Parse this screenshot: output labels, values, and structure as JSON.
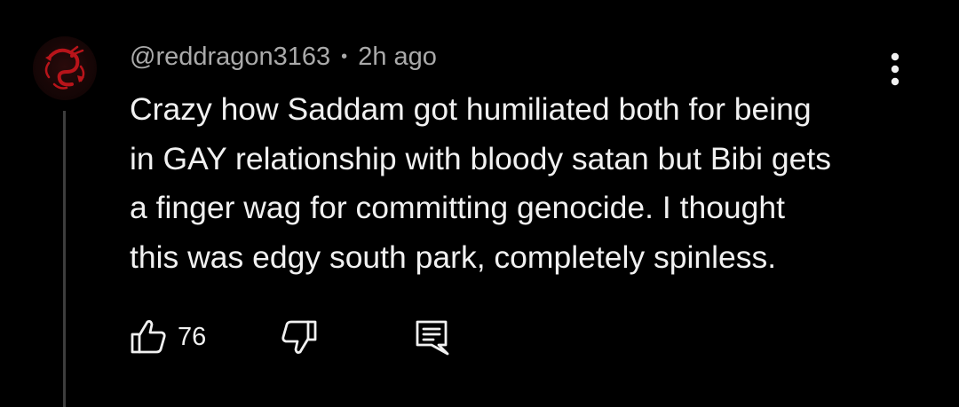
{
  "comment": {
    "author_handle": "@reddragon3163",
    "separator": "•",
    "timestamp": "2h ago",
    "text": "Crazy how Saddam got humiliated both for being\nin GAY relationship with bloody satan but Bibi gets\na finger wag for committing genocide. I thought\nthis was edgy south park, completely spinless.",
    "like_count": "76"
  },
  "icons": {
    "avatar": "red-dragon-avatar",
    "more": "more-vert-icon",
    "like": "thumbs-up-icon",
    "dislike": "thumbs-down-icon",
    "reply": "reply-comment-icon"
  },
  "colors": {
    "background": "#000000",
    "text_primary": "#f1f1f1",
    "text_secondary": "#aaaaaa",
    "thread_line": "#3d3d3d",
    "avatar_red": "#b8141a"
  }
}
